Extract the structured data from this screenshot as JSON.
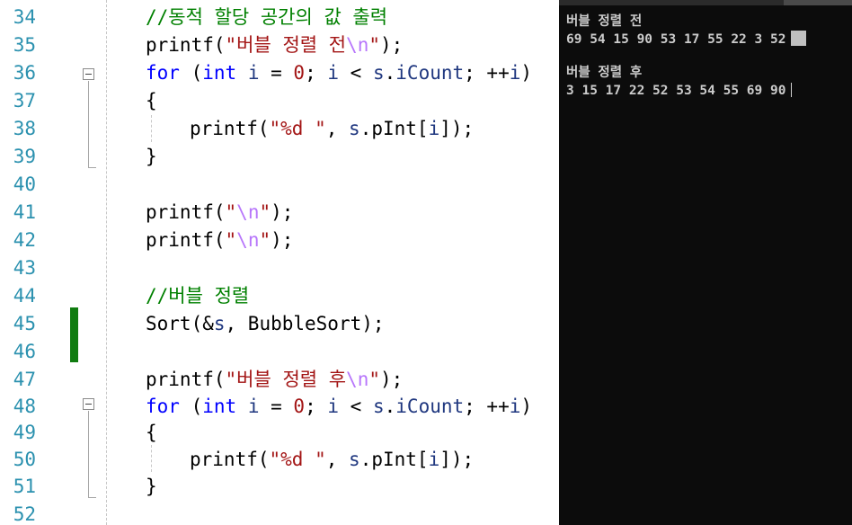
{
  "editor": {
    "lines": [
      {
        "n": "34",
        "t": [
          "//동적 할당 공간의 값 출력"
        ]
      },
      {
        "n": "35",
        "t": [
          "printf(",
          "\"버블 정렬 전",
          "\\n",
          "\"",
          ");"
        ]
      },
      {
        "n": "36",
        "t": [
          "for",
          " (",
          "int",
          " ",
          "i",
          " = ",
          "0",
          "; ",
          "i",
          " < ",
          "s",
          ".",
          "iCount",
          "; ++",
          "i",
          ")"
        ]
      },
      {
        "n": "37",
        "t": [
          "{"
        ]
      },
      {
        "n": "38",
        "t": [
          "printf(",
          "\"%d \"",
          ", ",
          "s",
          ".",
          "pInt",
          "[",
          "i",
          "]);"
        ]
      },
      {
        "n": "39",
        "t": [
          "}"
        ]
      },
      {
        "n": "40",
        "t": []
      },
      {
        "n": "41",
        "t": [
          "printf(",
          "\"",
          "\\n",
          "\"",
          ");"
        ]
      },
      {
        "n": "42",
        "t": [
          "printf(",
          "\"",
          "\\n",
          "\"",
          ");"
        ]
      },
      {
        "n": "43",
        "t": []
      },
      {
        "n": "44",
        "t": [
          "//버블 정렬"
        ]
      },
      {
        "n": "45",
        "t": [
          "Sort(&",
          "s",
          ", BubbleSort);"
        ]
      },
      {
        "n": "46",
        "t": []
      },
      {
        "n": "47",
        "t": [
          "printf(",
          "\"버블 정렬 후",
          "\\n",
          "\"",
          ");"
        ]
      },
      {
        "n": "48",
        "t": [
          "for",
          " (",
          "int",
          " ",
          "i",
          " = ",
          "0",
          "; ",
          "i",
          " < ",
          "s",
          ".",
          "iCount",
          "; ++",
          "i",
          ")"
        ]
      },
      {
        "n": "49",
        "t": [
          "{"
        ]
      },
      {
        "n": "50",
        "t": [
          "printf(",
          "\"%d \"",
          ", ",
          "s",
          ".",
          "pInt",
          "[",
          "i",
          "]);"
        ]
      },
      {
        "n": "51",
        "t": [
          "}"
        ]
      },
      {
        "n": "52",
        "t": []
      }
    ]
  },
  "console": {
    "lines": [
      "버블 정렬 전",
      "69 54 15 90 53 17 55 22 3 52",
      "",
      "버블 정렬 후",
      "3 15 17 22 52 53 54 55 69 90"
    ]
  },
  "colors": {
    "keyword": "#0000ff",
    "string": "#a31515",
    "escape": "#b776fb",
    "comment": "#008000",
    "line_number": "#2b91af",
    "change_bar": "#107c10",
    "console_bg": "#0c0c0c",
    "console_text": "#cccccc"
  },
  "icons": [
    "fold-collapse-icon"
  ]
}
